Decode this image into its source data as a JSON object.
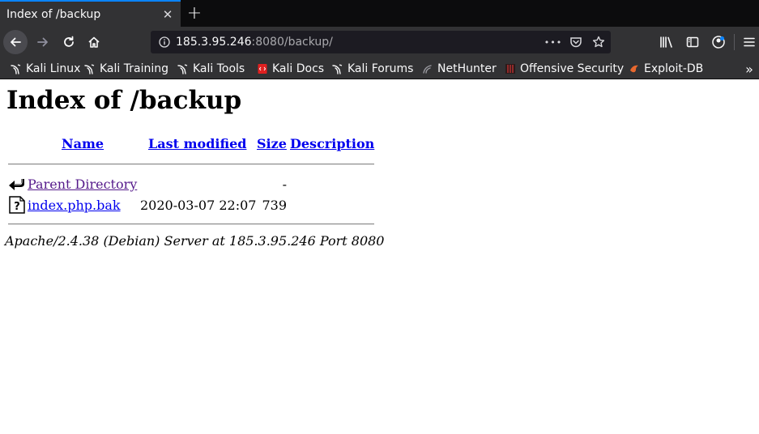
{
  "browser": {
    "tab": {
      "title": "Index of /backup",
      "close": "✕"
    },
    "new_tab": "+",
    "url": {
      "host": "185.3.95.246",
      "rest": ":8080/backup/"
    },
    "url_actions": {
      "more": "•••"
    },
    "bookmarks": [
      {
        "label": "Kali Linux",
        "icon": "kali-dragon-icon"
      },
      {
        "label": "Kali Training",
        "icon": "kali-dragon-icon"
      },
      {
        "label": "Kali Tools",
        "icon": "kali-dragon-icon"
      },
      {
        "label": "Kali Docs",
        "icon": "kali-docs-icon"
      },
      {
        "label": "Kali Forums",
        "icon": "kali-dragon-icon"
      },
      {
        "label": "NetHunter",
        "icon": "nethunter-icon"
      },
      {
        "label": "Offensive Security",
        "icon": "offsec-icon"
      },
      {
        "label": "Exploit-DB",
        "icon": "exploitdb-icon"
      }
    ],
    "bookmarks_overflow": "»",
    "colors": {
      "accent": "#0a84ff",
      "toolbar": "#323234",
      "tabbar": "#0c0c0d"
    }
  },
  "page": {
    "heading": "Index of /backup",
    "columns": {
      "name": "Name",
      "last_modified": "Last modified",
      "size": "Size",
      "description": "Description"
    },
    "rows": [
      {
        "name": "Parent Directory",
        "modified": "",
        "size": "-",
        "icon": "back-arrow-icon"
      },
      {
        "name": "index.php.bak",
        "modified": "2020-03-07 22:07",
        "size": "739",
        "icon": "unknown-file-icon"
      }
    ],
    "address": "Apache/2.4.38 (Debian) Server at 185.3.95.246 Port 8080"
  }
}
